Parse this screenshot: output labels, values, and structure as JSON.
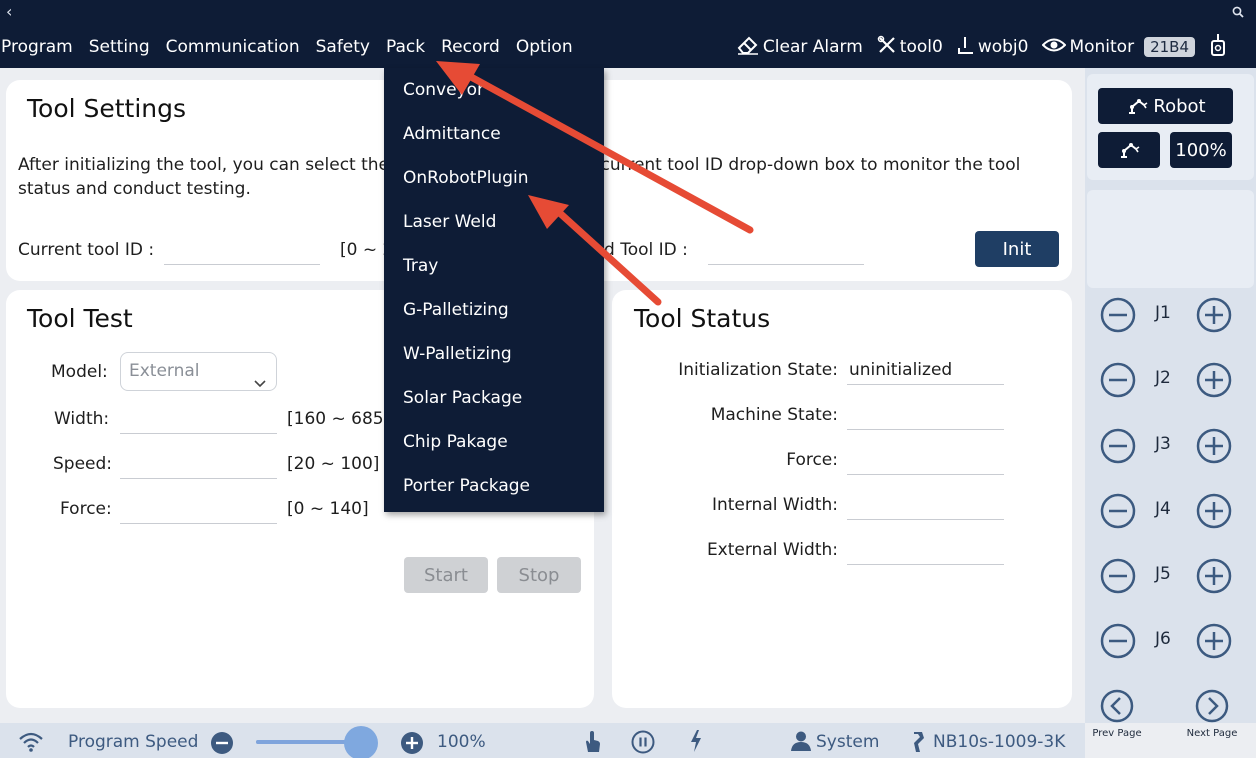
{
  "topbar": {
    "menu": [
      "Program",
      "Setting",
      "Communication",
      "Safety",
      "Pack",
      "Record",
      "Option"
    ],
    "clear_alarm": "Clear Alarm",
    "tool": "tool0",
    "wobj": "wobj0",
    "monitor": "Monitor",
    "badge": "21B4"
  },
  "dropdown": {
    "items": [
      "Conveyor",
      "Admittance",
      "OnRobotPlugin",
      "Laser Weld",
      "Tray",
      "G-Palletizing",
      "W-Palletizing",
      "Solar Package",
      "Chip Pakage",
      "Porter Package"
    ]
  },
  "settings": {
    "title": "Tool Settings",
    "desc_line1": "After initializing the tool, you can select the current tool ID from the current tool ID drop-down box to monitor the tool",
    "desc_line2": "status and conduct testing.",
    "current_tool_label": "Current tool ID :",
    "range": "[0 ~ 2",
    "selected_tool_label": "d Tool ID :",
    "init_button": "Init"
  },
  "test": {
    "title": "Tool Test",
    "model_label": "Model:",
    "model_value": "External",
    "width_label": "Width:",
    "width_range": "[160 ~ 685]",
    "speed_label": "Speed:",
    "speed_range": "[20 ~ 100]",
    "force_label": "Force:",
    "force_range": "[0 ~ 140]",
    "start_button": "Start",
    "stop_button": "Stop"
  },
  "status": {
    "title": "Tool Status",
    "init_state_label": "Initialization State:",
    "init_state_value": "uninitialized",
    "machine_state_label": "Machine State:",
    "force_label": "Force:",
    "internal_width_label": "Internal Width:",
    "external_width_label": "External Width:"
  },
  "side": {
    "robot_button": "Robot",
    "percent": "100%",
    "joints": [
      "J1",
      "J2",
      "J3",
      "J4",
      "J5",
      "J6"
    ],
    "prev_page": "Prev Page",
    "next_page": "Next Page"
  },
  "bottom": {
    "program_speed": "Program Speed",
    "speed_value": "100%",
    "speed_fraction": 1.0,
    "user": "System",
    "device": "NB10s-1009-3K"
  },
  "colors": {
    "navy": "#0e1c36",
    "button_blue": "#1f3e64",
    "annotation_arrow": "#e64b35"
  }
}
